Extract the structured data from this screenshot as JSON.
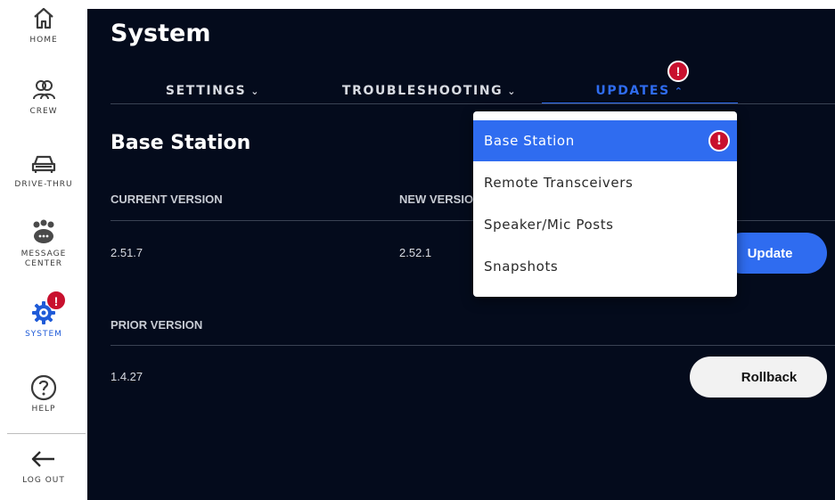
{
  "sidebar": {
    "items": [
      {
        "label": "HOME",
        "icon": "home-icon"
      },
      {
        "label": "CREW",
        "icon": "crew-icon"
      },
      {
        "label": "DRIVE-THRU",
        "icon": "car-icon"
      },
      {
        "label": "MESSAGE CENTER",
        "icon": "message-center-icon"
      },
      {
        "label": "SYSTEM",
        "icon": "gear-icon",
        "badge": "!"
      },
      {
        "label": "HELP",
        "icon": "help-icon"
      },
      {
        "label": "LOG OUT",
        "icon": "arrow-left-icon"
      }
    ]
  },
  "page": {
    "title": "System"
  },
  "tabs": [
    {
      "label": "SETTINGS",
      "chevron": "⌄"
    },
    {
      "label": "TROUBLESHOOTING",
      "chevron": "⌄"
    },
    {
      "label": "UPDATES",
      "chevron": "⌃",
      "badge": "!"
    }
  ],
  "section": {
    "title": "Base Station",
    "current_version_header": "CURRENT VERSION",
    "new_version_header": "NEW VERSION",
    "current_version": "2.51.7",
    "new_version": "2.52.1",
    "prior_version_header": "PRIOR VERSION",
    "prior_version": "1.4.27",
    "update_button": "Update",
    "rollback_button": "Rollback"
  },
  "dropdown": {
    "items": [
      {
        "label": "Base Station",
        "badge": "!"
      },
      {
        "label": "Remote Transceivers"
      },
      {
        "label": "Speaker/Mic Posts"
      },
      {
        "label": "Snapshots"
      }
    ]
  },
  "colors": {
    "accent": "#2f6cf0",
    "alert": "#c8102e",
    "background": "#040b1c"
  }
}
